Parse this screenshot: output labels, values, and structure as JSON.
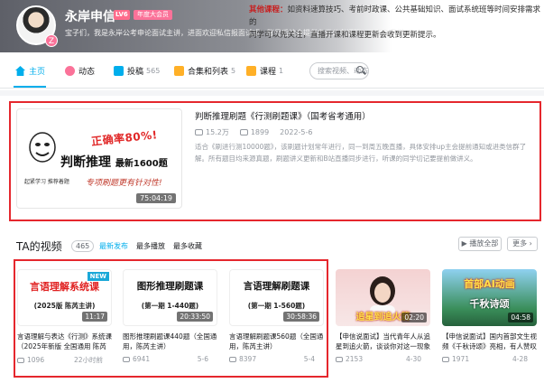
{
  "profile": {
    "name": "永岸申信",
    "level": "LV6",
    "vip": "年度大会员",
    "avatar_badge": "Z",
    "signature": "宝子们，我是永岸公考申论面试主讲，进面欢迎私信报面试班，账号后续会提供各类公考课程，欢迎免费学习！"
  },
  "notice": {
    "prefix": "其他课程：",
    "line1_rest": "如资料速算技巧、考前时政课、公共基础知识、面试系统班等时间安排需求的",
    "line2": "同学可以先关注，直播开课和课程更新会收到更新提示。"
  },
  "nav": {
    "home": "主页",
    "dynamic": "动态",
    "posts": "投稿",
    "posts_count": "565",
    "collections": "合集和列表",
    "collections_count": "5",
    "courses": "课程",
    "courses_count": "1",
    "search_placeholder": "搜索视频、动态"
  },
  "featured": {
    "title": "判断推理刷题《行测刷题课》（国考省考通用）",
    "views": "15.2万",
    "danmaku": "1899",
    "date": "2022-5-6",
    "description": "适合《刷进行测10000题》，该刷题计划常年进行，同一到周五晚直播，具体安排up主会提前通知或进类信群了解。所有题目均来源真题，刷题讲义更新和B站直播同步进行，听课的同学切记要提前做讲义。",
    "thumb_red": "正确率80%!",
    "thumb_main": "判断推理",
    "thumb_main_sub": "最新1600题",
    "thumb_small": "起紧学习 推荐着题",
    "thumb_script": "专项刷题更有针对性!",
    "duration": "75:04:19"
  },
  "section": {
    "title": "TA的视频",
    "count": "465",
    "sort_latest": "最新发布",
    "sort_most_played": "最多播放",
    "sort_most_fav": "最多收藏",
    "play_all": "播放全部",
    "more": "更多"
  },
  "videos": [
    {
      "thumb_big": "言语理解系统课",
      "thumb_sub": "(2025版  陈芮主讲)",
      "badge": "NEW",
      "duration": "11:17",
      "title": "言语理解与表达《行测》系统课（2025年新版 全国通用 陈芮主讲）",
      "views": "1096",
      "date": "22小时前"
    },
    {
      "thumb_big": "图形推理刷题课",
      "thumb_sub": "(第一期 1-440题)",
      "duration": "20:33:50",
      "title": "图形推理刷题课440题（全国通用，陈芮主讲）",
      "views": "6941",
      "date": "5-6"
    },
    {
      "thumb_big": "言语理解刷题课",
      "thumb_sub": "(第一期 1-560题)",
      "duration": "30:58:36",
      "title": "言语理解刷题课560题（全国通用，陈芮主讲）",
      "views": "8397",
      "date": "5-4"
    },
    {
      "thumb_big": "追星到追火箭",
      "duration": "02:20",
      "title": "【申信说面试】当代青年人从追星到追火箭，谈谈你对这一现象的看法",
      "views": "2153",
      "date": "4-30"
    },
    {
      "thumb_big": "首部AI动画",
      "thumb_sub": "千秋诗颂",
      "duration": "04:58",
      "title": "【申信说面试】国内首部文生视频《千秋诗颂》亮相，有人赞叹有人担忧",
      "views": "1971",
      "date": "4-28"
    }
  ],
  "colors": {
    "accent": "#00aeec",
    "highlight_frame": "#e5272d",
    "pink": "#fb7299"
  }
}
